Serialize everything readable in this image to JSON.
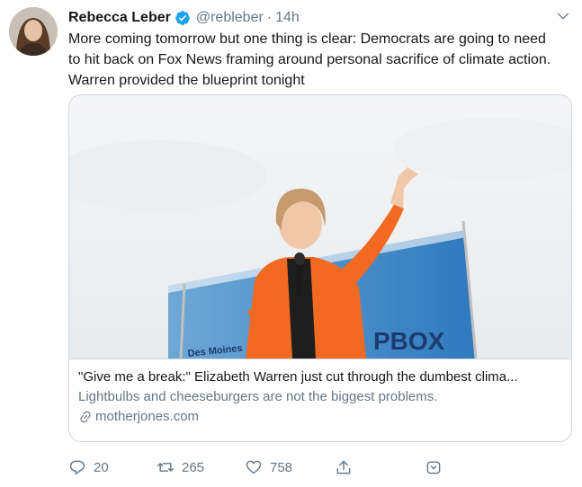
{
  "author": {
    "name": "Rebecca Leber",
    "handle": "@rebleber",
    "separator": "·",
    "time": "14h",
    "verified": true
  },
  "tweet": {
    "lines": [
      "More coming tomorrow but one thing is clear: Democrats are going to need",
      "to hit back on Fox News framing around personal sacrifice of climate action.",
      "Warren provided the blueprint tonight"
    ]
  },
  "card": {
    "image_sign_text_left": "Des Moines",
    "image_sign_text_right": "PBOX",
    "title": "\"Give me a break:\" Elizabeth Warren just cut through the dumbest clima...",
    "description": "Lightbulbs and cheeseburgers are not the biggest problems.",
    "domain": "motherjones.com"
  },
  "actions": {
    "replies": "20",
    "retweets": "265",
    "likes": "758"
  },
  "icons": {
    "verified": "verified-badge-icon",
    "menu": "chevron-down-icon",
    "reply": "reply-icon",
    "retweet": "retweet-icon",
    "like": "heart-icon",
    "share": "share-icon",
    "save": "bookmark-icon",
    "link": "link-icon"
  },
  "colors": {
    "accent": "#1da1f2",
    "muted": "#657786",
    "text": "#14171a",
    "jacket": "#f26a21"
  }
}
